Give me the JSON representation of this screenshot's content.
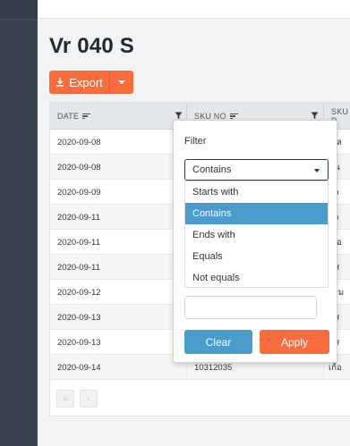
{
  "page": {
    "title": "Vr 040 S"
  },
  "toolbar": {
    "export_label": "Export",
    "export_icon": "download-icon"
  },
  "grid": {
    "columns": [
      {
        "label": "DATE"
      },
      {
        "label": "SKU NO"
      },
      {
        "label": "SKU D"
      }
    ],
    "rows": [
      {
        "date": "2020-09-08",
        "sku_no": "",
        "sku_desc": "เกล"
      },
      {
        "date": "2020-09-08",
        "sku_no": "",
        "sku_desc": "มน"
      },
      {
        "date": "2020-09-09",
        "sku_no": "",
        "sku_desc": "หว"
      },
      {
        "date": "2020-09-11",
        "sku_no": "",
        "sku_desc": "มว"
      },
      {
        "date": "2020-09-11",
        "sku_no": "",
        "sku_desc": "เก้อ"
      },
      {
        "date": "2020-09-11",
        "sku_no": "",
        "sku_desc": "คส"
      },
      {
        "date": "2020-09-12",
        "sku_no": "",
        "sku_desc": "กรม"
      },
      {
        "date": "2020-09-13",
        "sku_no": "",
        "sku_desc": "คส"
      },
      {
        "date": "2020-09-13",
        "sku_no": "",
        "sku_desc": "คส"
      },
      {
        "date": "2020-09-14",
        "sku_no": "10312035",
        "sku_desc": "เก้อ"
      }
    ],
    "pager": {
      "first": "«",
      "prev": "‹"
    }
  },
  "filter": {
    "title": "Filter",
    "selected": "Contains",
    "options": [
      "Starts with",
      "Contains",
      "Ends with",
      "Equals",
      "Not equals"
    ],
    "input_value": "",
    "clear_label": "Clear",
    "apply_label": "Apply"
  },
  "colors": {
    "accent": "#f86c3e",
    "selection": "#4a9ccc",
    "sidebar": "#39434d"
  }
}
